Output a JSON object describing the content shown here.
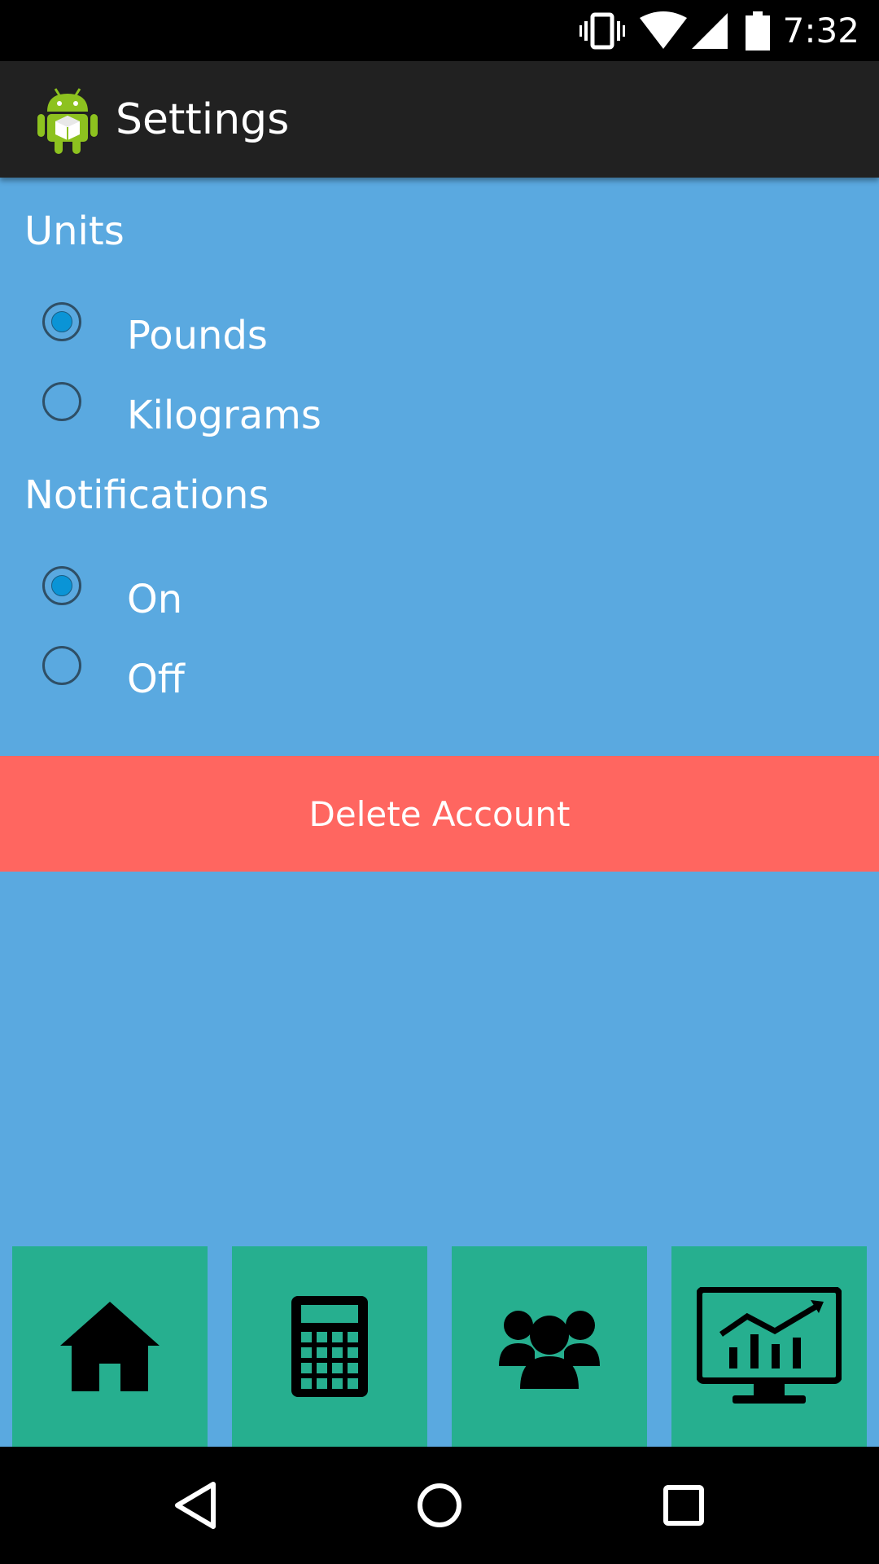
{
  "status_bar": {
    "time": "7:32",
    "icons": [
      "vibrate-icon",
      "wifi-icon",
      "cell-signal-icon",
      "battery-icon"
    ]
  },
  "action_bar": {
    "title": "Settings",
    "logo": "android-app-icon"
  },
  "settings": {
    "units": {
      "heading": "Units",
      "options": [
        {
          "label": "Pounds",
          "checked": true
        },
        {
          "label": "Kilograms",
          "checked": false
        }
      ]
    },
    "notifications": {
      "heading": "Notifications",
      "options": [
        {
          "label": "On",
          "checked": true
        },
        {
          "label": "Off",
          "checked": false
        }
      ]
    },
    "delete_button_label": "Delete Account"
  },
  "bottom_tabs": [
    {
      "icon": "home-icon"
    },
    {
      "icon": "calculator-icon"
    },
    {
      "icon": "group-icon"
    },
    {
      "icon": "monitor-chart-icon"
    }
  ],
  "nav_bar": {
    "buttons": [
      "back-icon",
      "home-circle-icon",
      "recents-icon"
    ]
  },
  "colors": {
    "background": "#5aa9e0",
    "action_bar": "#212121",
    "delete_button": "#ff6660",
    "tab_tile": "#26af8f",
    "radio_checked": "#0a94d6"
  }
}
